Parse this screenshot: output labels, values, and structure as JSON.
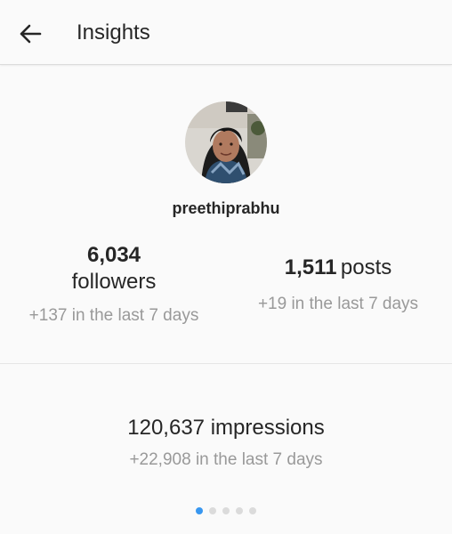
{
  "header": {
    "title": "Insights",
    "back_icon": "arrow-left-icon"
  },
  "profile": {
    "username": "preethiprabhu",
    "avatar_icon": "profile-photo"
  },
  "stats": {
    "followers": {
      "value": "6,034",
      "label": "followers",
      "delta": "+137 in the last 7 days"
    },
    "posts": {
      "value": "1,511",
      "label": "posts",
      "delta": "+19 in the last 7 days"
    }
  },
  "impressions": {
    "text": "120,637 impressions",
    "delta": "+22,908 in the last 7 days"
  },
  "pager": {
    "count": 5,
    "active_index": 0,
    "active_color": "#3897f0",
    "inactive_color": "#dbdbdb"
  }
}
